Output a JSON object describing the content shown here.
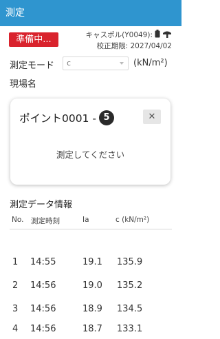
{
  "app": {
    "title": "測定"
  },
  "status": {
    "badge": "準備中..."
  },
  "device": {
    "name": "キャスポル(Y0049):",
    "calibration": "校正期限: 2027/04/02"
  },
  "mode": {
    "label": "測定モード",
    "selected": "c",
    "unit": "(kN/m²)"
  },
  "site": {
    "label": "現場名"
  },
  "card": {
    "title": "ポイント0001 -",
    "count": "5",
    "close_symbol": "✕",
    "message": "測定してください"
  },
  "data_section": {
    "title": "測定データ情報",
    "columns": [
      "No.",
      "測定時刻",
      "Ia",
      "c (kN/m²)"
    ],
    "rows": [
      [
        "1",
        "14:55",
        "19.1",
        "135.9"
      ],
      [
        "2",
        "14:56",
        "19.0",
        "135.2"
      ],
      [
        "3",
        "14:56",
        "18.9",
        "134.5"
      ],
      [
        "4",
        "14:56",
        "18.7",
        "133.1"
      ]
    ]
  },
  "colors": {
    "appbar": "#2f95cf",
    "status_badge": "#d9232d"
  }
}
